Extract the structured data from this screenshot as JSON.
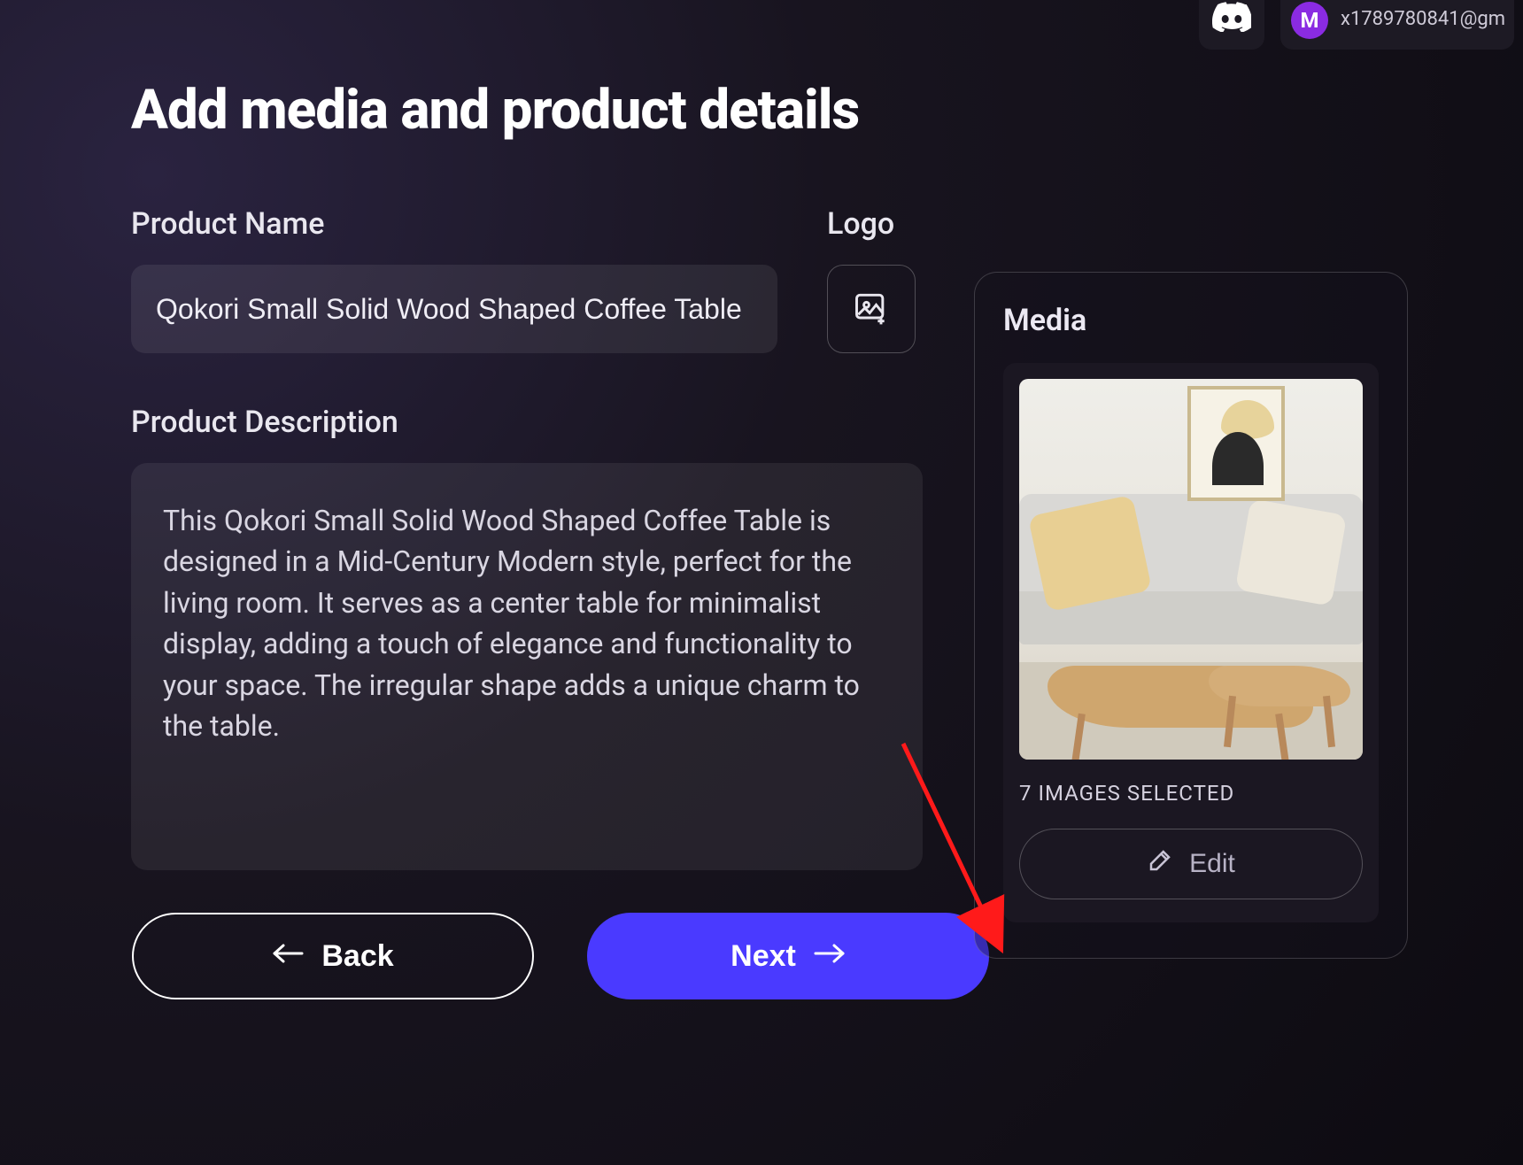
{
  "header": {
    "user_initial": "M",
    "user_email": "x1789780841@gm"
  },
  "page": {
    "title": "Add media and product details"
  },
  "form": {
    "product_name_label": "Product Name",
    "product_name_value": "Qokori Small Solid Wood Shaped Coffee Table",
    "logo_label": "Logo",
    "description_label": "Product Description",
    "description_value": "This Qokori Small Solid Wood Shaped Coffee Table is designed in a Mid-Century Modern style, perfect for the living room. It serves as a center table for minimalist display, adding a touch of elegance and functionality to your space. The irregular shape adds a unique charm to the table."
  },
  "media": {
    "panel_title": "Media",
    "selected_caption": "7 IMAGES SELECTED",
    "edit_label": "Edit"
  },
  "buttons": {
    "back": "Back",
    "next": "Next"
  }
}
